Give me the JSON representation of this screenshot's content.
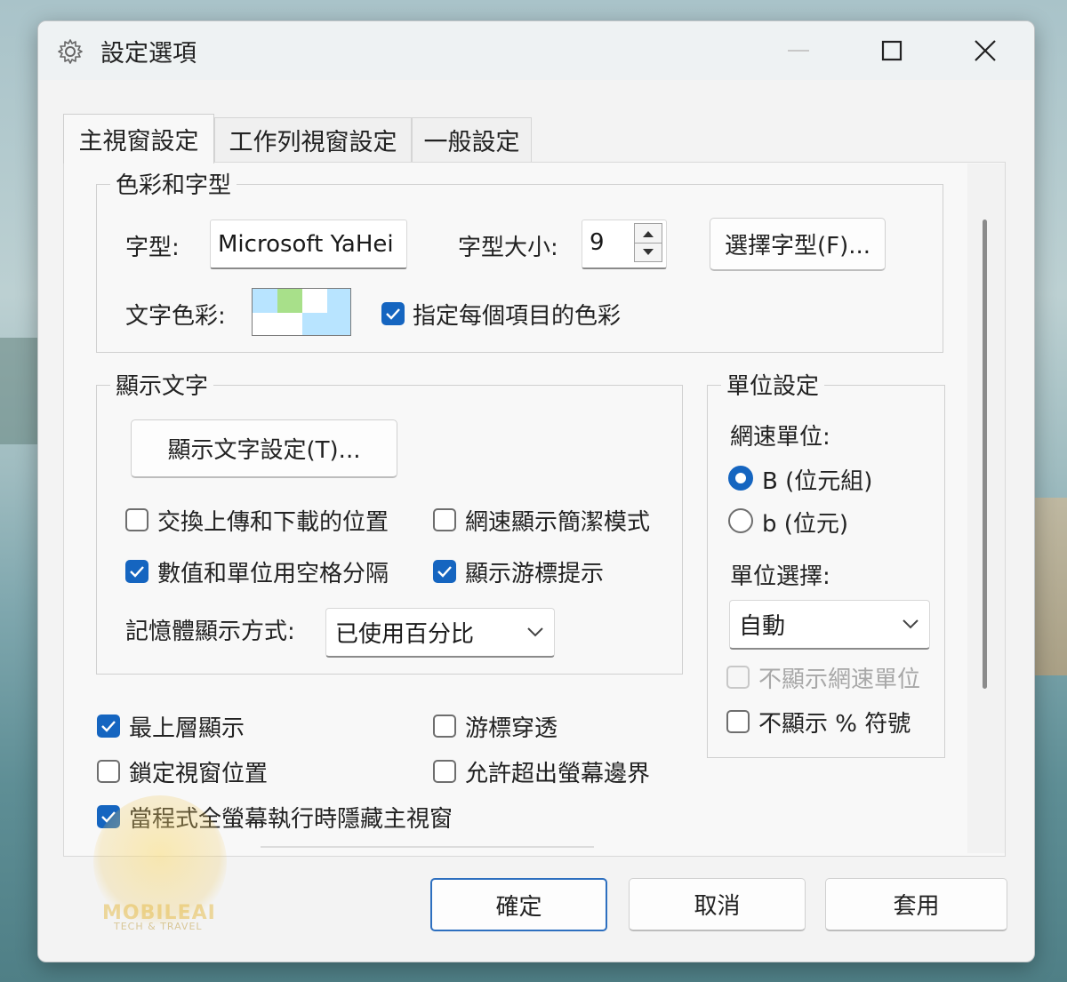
{
  "window": {
    "title": "設定選項",
    "icon": "gear-icon"
  },
  "tabs": [
    {
      "label": "主視窗設定",
      "active": true
    },
    {
      "label": "工作列視窗設定",
      "active": false
    },
    {
      "label": "一般設定",
      "active": false
    }
  ],
  "color_font": {
    "legend": "色彩和字型",
    "font_label": "字型:",
    "font_value": "Microsoft YaHei",
    "size_label": "字型大小:",
    "size_value": "9",
    "choose_font_button": "選擇字型(F)...",
    "text_color_label": "文字色彩:",
    "per_item_color_label": "指定每個項目的色彩",
    "per_item_color_checked": true
  },
  "display_text": {
    "legend": "顯示文字",
    "settings_button": "顯示文字設定(T)...",
    "swap_upload_download": "交換上傳和下載的位置",
    "swap_checked": false,
    "simple_mode": "網速顯示簡潔模式",
    "simple_checked": false,
    "space_separator": "數值和單位用空格分隔",
    "space_checked": true,
    "show_tooltip": "顯示游標提示",
    "tooltip_checked": true,
    "memory_label": "記憶體顯示方式:",
    "memory_value": "已使用百分比"
  },
  "unit_settings": {
    "legend": "單位設定",
    "speed_unit_label": "網速單位:",
    "byte_option": "B (位元組)",
    "byte_selected": true,
    "bit_option": "b (位元)",
    "bit_selected": false,
    "unit_select_label": "單位選擇:",
    "unit_select_value": "自動",
    "hide_unit": "不顯示網速單位",
    "hide_unit_checked": false,
    "hide_percent": "不顯示 % 符號",
    "hide_percent_checked": false
  },
  "bottom_options": {
    "topmost": "最上層顯示",
    "topmost_checked": true,
    "mouse_through": "游標穿透",
    "mouse_through_checked": false,
    "lock_position": "鎖定視窗位置",
    "lock_checked": false,
    "allow_offscreen": "允許超出螢幕邊界",
    "allow_offscreen_checked": false,
    "hide_fullscreen": "當程式全螢幕執行時隱藏主視窗",
    "hide_fullscreen_checked": true
  },
  "footer": {
    "ok": "確定",
    "cancel": "取消",
    "apply": "套用"
  },
  "watermark": {
    "brand": "MOBILEAI",
    "tagline": "TECH & TRAVEL"
  },
  "colors": {
    "accent": "#1565c0",
    "swatch_1": "#b8e4ff",
    "swatch_2": "#a8e08a",
    "swatch_3": "#ffffff"
  }
}
